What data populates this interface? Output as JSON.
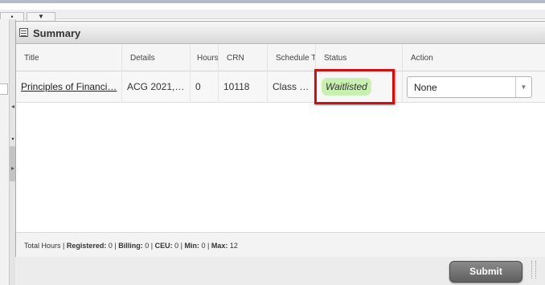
{
  "top_tabs": {
    "tab1_glyph": "•",
    "tab2_glyph": "▼"
  },
  "left_nav": {
    "arrow_left": "◂",
    "bullet": "•",
    "arrow_right": "▸"
  },
  "summary": {
    "title": "Summary",
    "columns": [
      "Title",
      "Details",
      "Hours",
      "CRN",
      "Schedule Type",
      "Status",
      "Action"
    ],
    "rows": [
      {
        "title": "Principles of Financial Accounting",
        "title_display": "Principles of Financi…",
        "details_display": "ACG 2021,…",
        "hours": "0",
        "crn": "10118",
        "schedule_type_display": "Class …",
        "status": "Waitlisted",
        "action": "None"
      }
    ],
    "footer": {
      "label": "Total Hours",
      "registered_label": "Registered:",
      "registered": "0",
      "billing_label": "Billing:",
      "billing": "0",
      "ceu_label": "CEU:",
      "ceu": "0",
      "min_label": "Min:",
      "min": "0",
      "max_label": "Max:",
      "max": "12"
    }
  },
  "submit_label": "Submit",
  "icons": {
    "gear": "⚙",
    "gear_caret": "▼",
    "select_arrow": "▼"
  },
  "colors": {
    "status_highlight": "#c8f0b0",
    "annotation_box": "#d01010",
    "submit_button": "#6e6e6e"
  }
}
